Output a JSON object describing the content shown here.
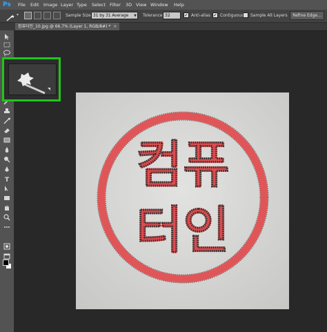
{
  "app": {
    "logo": "Ps"
  },
  "menu": [
    "File",
    "Edit",
    "Image",
    "Layer",
    "Type",
    "Select",
    "Filter",
    "3D",
    "View",
    "Window",
    "Help"
  ],
  "options": {
    "sample_size_label": "Sample Size:",
    "sample_size_value": "31 by 31 Average",
    "tolerance_label": "Tolerance:",
    "tolerance_value": "32",
    "anti_alias_label": "Anti-alias",
    "anti_alias_checked": true,
    "contiguous_label": "Contiguous",
    "contiguous_checked": true,
    "sample_all_layers_label": "Sample All Layers",
    "sample_all_layers_checked": false,
    "refine_edge_label": "Refine Edge..."
  },
  "document_tab": {
    "title": "컴퓨터인_10.jpg @ 66.7% (Layer 1, RGB/8#) *",
    "close": "×"
  },
  "tools": [
    "move-tool",
    "marquee-tool",
    "lasso-tool",
    "quick-selection-tool",
    "crop-tool",
    "eyedropper-tool",
    "spot-healing-tool",
    "brush-tool",
    "clone-stamp-tool",
    "history-brush-tool",
    "eraser-tool",
    "gradient-tool",
    "blur-tool",
    "dodge-tool",
    "pen-tool",
    "type-tool",
    "path-selection-tool",
    "shape-tool",
    "hand-tool",
    "zoom-tool"
  ],
  "stamp": {
    "lines": [
      "컴퓨",
      "터인"
    ],
    "color": "#d9474a"
  },
  "colors": {
    "foreground": "#000000",
    "background": "#ffffff",
    "highlight": "#22c51c",
    "accent": "#31a8ff"
  }
}
